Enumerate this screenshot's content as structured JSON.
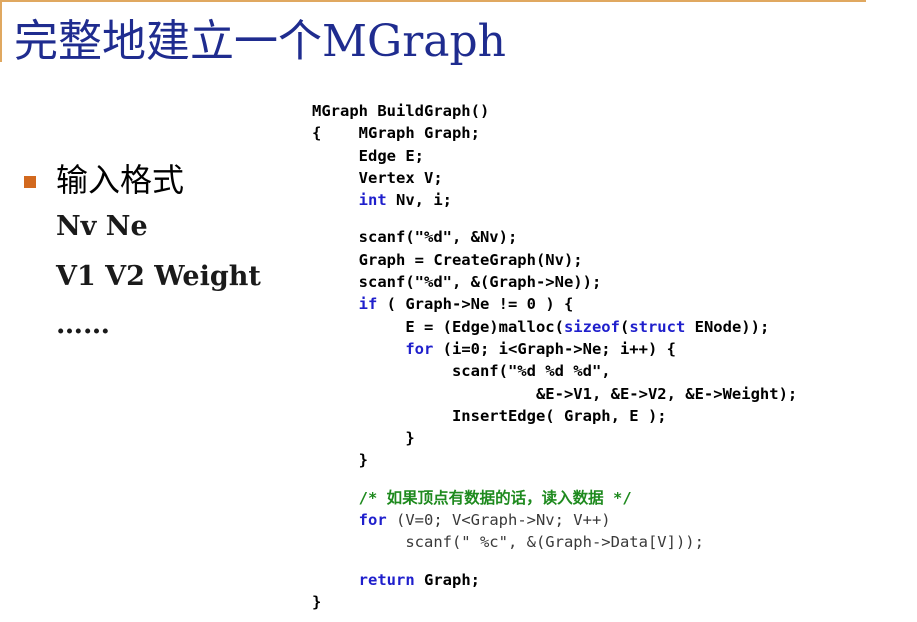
{
  "title": "完整地建立一个MGraph",
  "bullet": {
    "label": "输入格式",
    "lines": [
      "Nv Ne",
      "V1  V2  Weight",
      "……"
    ]
  },
  "code": {
    "lines": [
      [
        {
          "t": "MGraph BuildGraph()"
        }
      ],
      [
        {
          "t": "{    MGraph Graph;"
        }
      ],
      [
        {
          "t": "     Edge E;"
        }
      ],
      [
        {
          "t": "     Vertex V;"
        }
      ],
      [
        {
          "t": "     "
        },
        {
          "t": "int",
          "c": "kw"
        },
        {
          "t": " Nv, i;"
        }
      ],
      [],
      [
        {
          "t": "     scanf(\"%d\", &Nv);"
        }
      ],
      [
        {
          "t": "     Graph = CreateGraph(Nv);"
        }
      ],
      [
        {
          "t": "     scanf(\"%d\", &(Graph->Ne));"
        }
      ],
      [
        {
          "t": "     "
        },
        {
          "t": "if",
          "c": "kw"
        },
        {
          "t": " ( Graph->Ne != 0 ) {"
        }
      ],
      [
        {
          "t": "          E = (Edge)malloc("
        },
        {
          "t": "sizeof",
          "c": "kw"
        },
        {
          "t": "("
        },
        {
          "t": "struct",
          "c": "kw"
        },
        {
          "t": " ENode));"
        }
      ],
      [
        {
          "t": "          "
        },
        {
          "t": "for",
          "c": "kw"
        },
        {
          "t": " (i=0; i<Graph->Ne; i++) {"
        }
      ],
      [
        {
          "t": "               scanf(\"%d %d %d\","
        }
      ],
      [
        {
          "t": "                        &E->V1, &E->V2, &E->Weight);"
        }
      ],
      [
        {
          "t": "               InsertEdge( Graph, E );"
        }
      ],
      [
        {
          "t": "          }"
        }
      ],
      [
        {
          "t": "     }"
        }
      ],
      [],
      [
        {
          "t": "     "
        },
        {
          "t": "/* 如果顶点有数据的话，读入数据 */",
          "c": "cm"
        }
      ],
      [
        {
          "t": "     "
        },
        {
          "t": "for",
          "c": "kw"
        },
        {
          "t": " (V=0; V<Graph->Nv; V++)",
          "c": "dim"
        }
      ],
      [
        {
          "t": "          scanf(\" %c\", &(Graph->Data[V]));",
          "c": "dim"
        }
      ],
      [],
      [
        {
          "t": "     "
        },
        {
          "t": "return",
          "c": "kw"
        },
        {
          "t": " Graph;"
        }
      ],
      [
        {
          "t": "}"
        }
      ]
    ]
  }
}
